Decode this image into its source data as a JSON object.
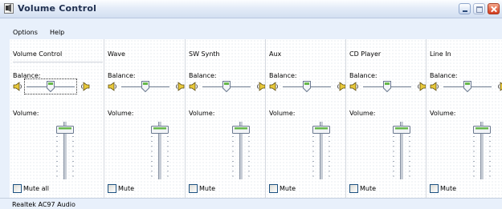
{
  "window": {
    "title": "Volume Control"
  },
  "menu": {
    "items": [
      "Options",
      "Help"
    ]
  },
  "labels": {
    "balance": "Balance:",
    "volume": "Volume:"
  },
  "channels": [
    {
      "name": "Volume Control",
      "mute_label": "Mute all",
      "muted": false,
      "balance": 0.5,
      "volume": 0.95
    },
    {
      "name": "Wave",
      "mute_label": "Mute",
      "muted": false,
      "balance": 0.5,
      "volume": 0.95
    },
    {
      "name": "SW Synth",
      "mute_label": "Mute",
      "muted": false,
      "balance": 0.5,
      "volume": 0.95
    },
    {
      "name": "Aux",
      "mute_label": "Mute",
      "muted": false,
      "balance": 0.5,
      "volume": 0.95
    },
    {
      "name": "CD Player",
      "mute_label": "Mute",
      "muted": false,
      "balance": 0.5,
      "volume": 0.95
    },
    {
      "name": "Line In",
      "mute_label": "Mute",
      "muted": false,
      "balance": 0.5,
      "volume": 0.95
    }
  ],
  "status": {
    "device": "Realtek AC97 Audio"
  },
  "icons": {
    "app": "speaker-app-icon",
    "balance_left": "speaker-left-icon",
    "balance_right": "speaker-right-icon",
    "min": "minimize-icon",
    "max": "maximize-icon",
    "close": "close-icon"
  },
  "colors": {
    "titlebar": "#dfe8f6",
    "close_button": "#d9442a",
    "thumb_accent": "#66b84a",
    "panel_background": "#ffffff"
  }
}
